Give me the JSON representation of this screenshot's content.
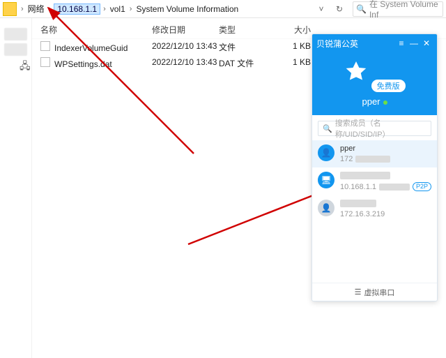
{
  "breadcrumb": {
    "root": "网络",
    "ip": "10.168.1.1",
    "vol": "vol1",
    "folder": "System Volume Information"
  },
  "search": {
    "placeholder": "在 System Volume Inf"
  },
  "columns": {
    "name": "名称",
    "date": "修改日期",
    "type": "类型",
    "size": "大小"
  },
  "files": [
    {
      "name": "IndexerVolumeGuid",
      "date": "2022/12/10 13:43",
      "type": "文件",
      "size": "1 KB"
    },
    {
      "name": "WPSettings.dat",
      "date": "2022/12/10 13:43",
      "type": "DAT 文件",
      "size": "1 KB"
    }
  ],
  "panel": {
    "title": "贝锐蒲公英",
    "badge": "免费版",
    "user": "pper",
    "search_placeholder": "搜索成员（名称/UID/SID/IP）",
    "members": [
      {
        "name": "pper",
        "sub_ip": "172",
        "obf_w": 50,
        "kind": "u",
        "selected": true
      },
      {
        "name": "",
        "sub_ip": "10.168.1.1",
        "obf_w": 60,
        "kind": "h",
        "selected": false,
        "p2p": "P2P",
        "name_obf_w": 72
      },
      {
        "name": "",
        "sub_ip": "172.16.3.219",
        "obf_w": 0,
        "kind": "g",
        "selected": false,
        "name_obf_w": 52
      }
    ],
    "footer": "虚拟串口"
  }
}
